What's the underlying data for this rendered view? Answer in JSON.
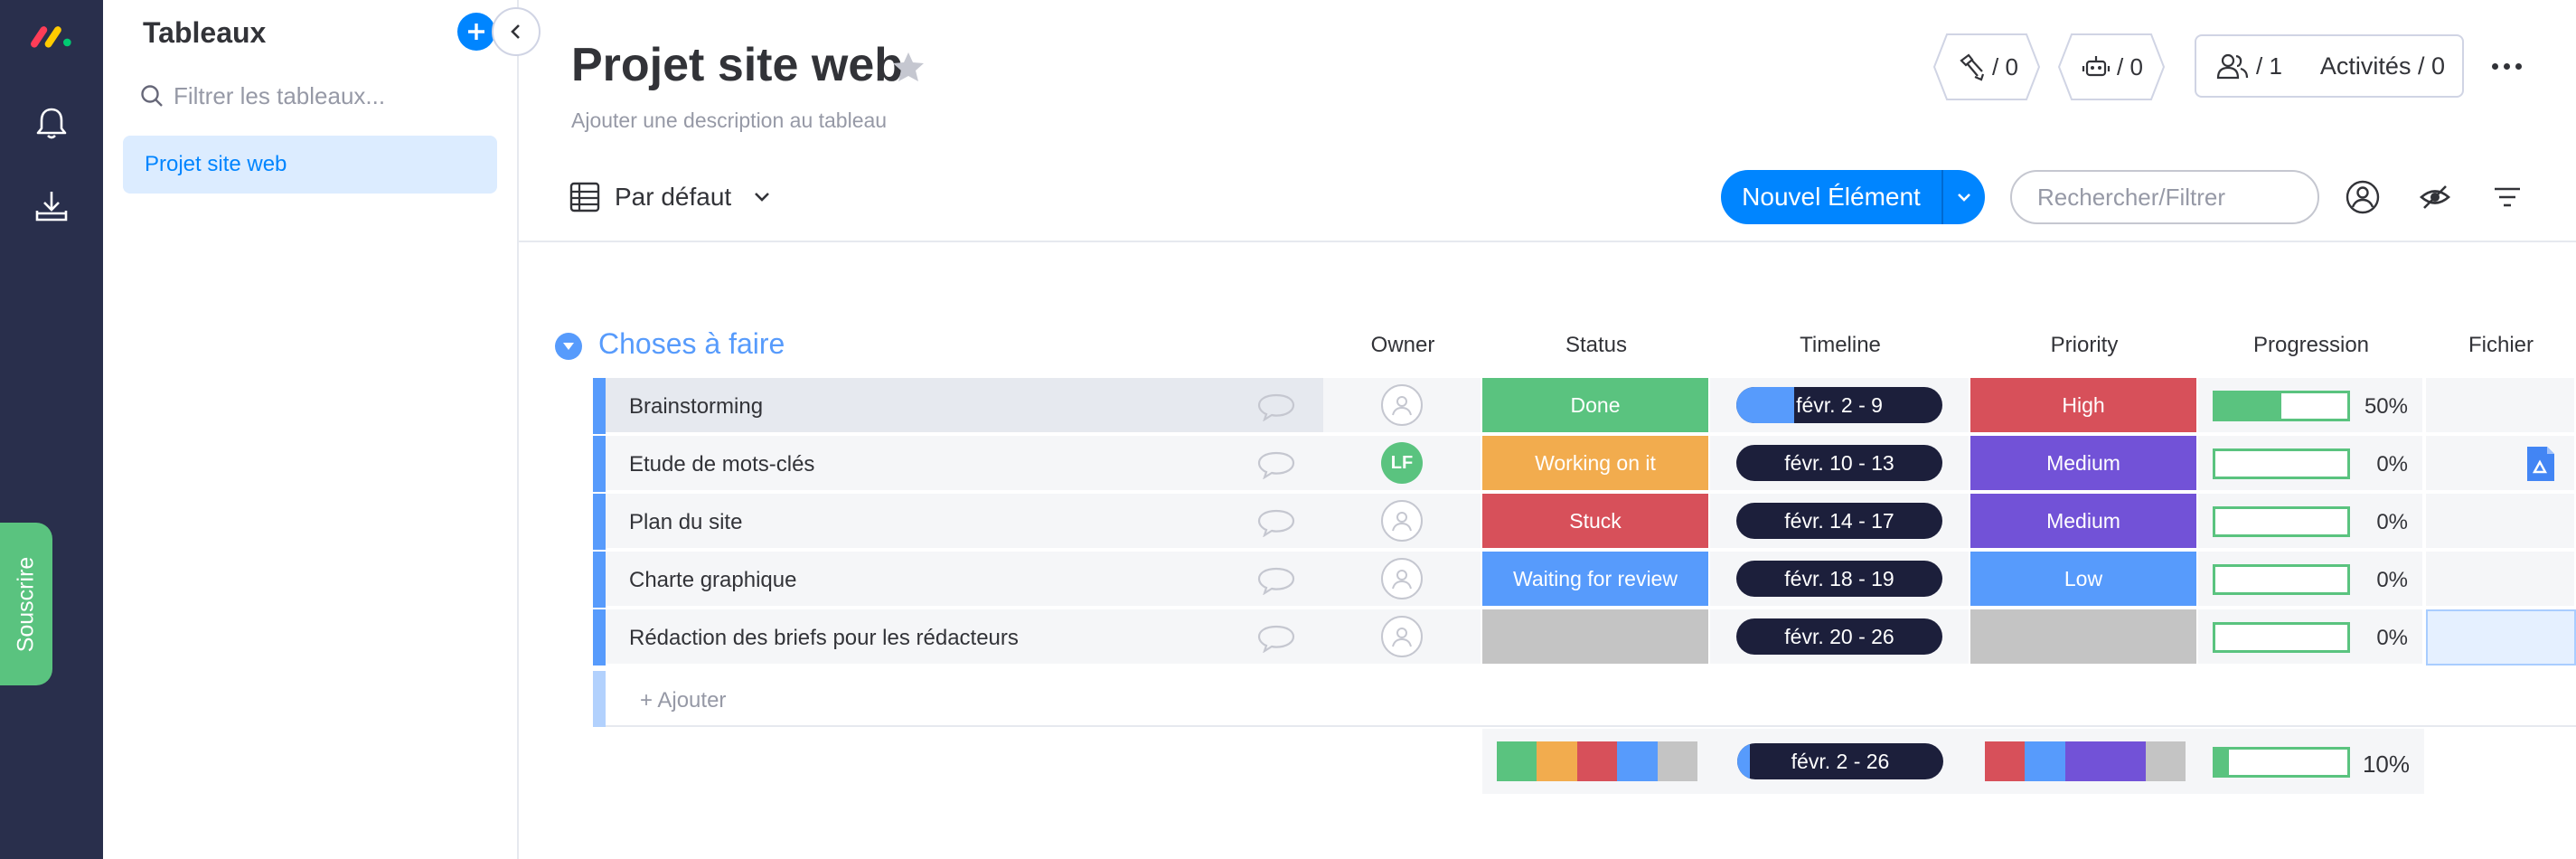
{
  "sidebar": {
    "title": "Tableaux",
    "search_placeholder": "Filtrer les tableaux...",
    "boards": [
      "Projet site web"
    ],
    "subscribe_label": "Souscrire"
  },
  "board": {
    "title": "Projet site web",
    "description": "Ajouter une description au tableau",
    "integrations_count": "/ 0",
    "automations_count": "/ 0",
    "members_count": "/ 1",
    "activities_label": "Activités / 0"
  },
  "toolbar": {
    "view_label": "Par défaut",
    "new_item_label": "Nouvel Élément",
    "search_placeholder": "Rechercher/Filtrer"
  },
  "group": {
    "title": "Choses à faire",
    "columns": {
      "owner": "Owner",
      "status": "Status",
      "timeline": "Timeline",
      "priority": "Priority",
      "progression": "Progression",
      "file": "Fichier"
    },
    "rows": [
      {
        "name": "Brainstorming",
        "owner": "",
        "status": "Done",
        "status_color": "#5ac37f",
        "timeline": "févr. 2 - 9",
        "timeline_elapsed": 0.28,
        "priority": "High",
        "priority_color": "#d7505a",
        "progress_value": 50,
        "progress": "50%",
        "file": ""
      },
      {
        "name": "Etude de mots-clés",
        "owner": "LF",
        "status": "Working on it",
        "status_color": "#f2ac4e",
        "timeline": "févr. 10 - 13",
        "timeline_elapsed": 0,
        "priority": "Medium",
        "priority_color": "#7252d7",
        "progress_value": 0,
        "progress": "0%",
        "file": "document-icon"
      },
      {
        "name": "Plan du site",
        "owner": "",
        "status": "Stuck",
        "status_color": "#d7505a",
        "timeline": "févr. 14 - 17",
        "timeline_elapsed": 0,
        "priority": "Medium",
        "priority_color": "#7252d7",
        "progress_value": 0,
        "progress": "0%",
        "file": ""
      },
      {
        "name": "Charte graphique",
        "owner": "",
        "status": "Waiting for review",
        "status_color": "#579bfc",
        "timeline": "févr. 18 - 19",
        "timeline_elapsed": 0,
        "priority": "Low",
        "priority_color": "#579bfc",
        "progress_value": 0,
        "progress": "0%",
        "file": ""
      },
      {
        "name": "Rédaction des briefs pour les rédacteurs",
        "owner": "",
        "status": "",
        "status_color": "#c4c4c4",
        "timeline": "févr. 20 - 26",
        "timeline_elapsed": 0,
        "priority": "",
        "priority_color": "#c4c4c4",
        "progress_value": 0,
        "progress": "0%",
        "file": ""
      }
    ],
    "add_label": "+ Ajouter",
    "summary": {
      "status_colors": [
        "#5ac37f",
        "#f2ac4e",
        "#d7505a",
        "#579bfc",
        "#c4c4c4"
      ],
      "timeline": "févr. 2 - 26",
      "timeline_elapsed": 0.06,
      "priority_colors": [
        "#d7505a",
        "#579bfc",
        "#7252d7",
        "#7252d7",
        "#c4c4c4"
      ],
      "progress_value": 10,
      "progress": "10%"
    }
  }
}
